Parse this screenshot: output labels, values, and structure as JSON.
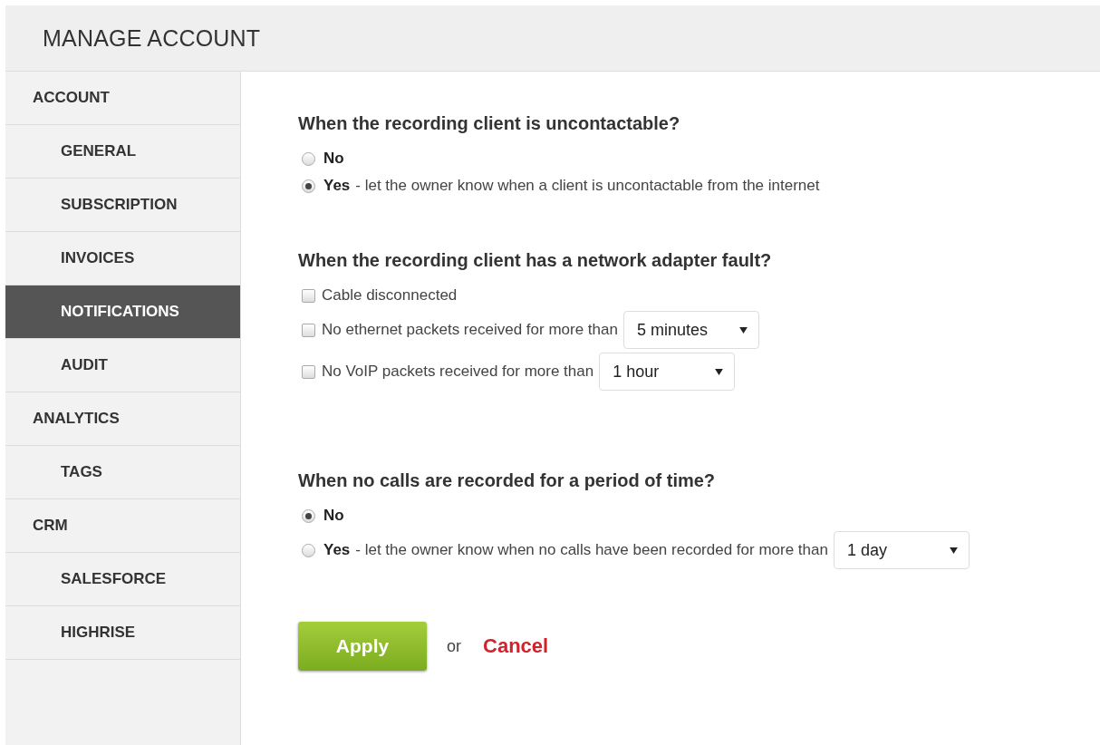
{
  "header": {
    "title": "MANAGE ACCOUNT"
  },
  "sidebar": {
    "items": [
      {
        "label": "ACCOUNT",
        "selected": false,
        "children": [
          {
            "label": "GENERAL",
            "selected": false
          },
          {
            "label": "SUBSCRIPTION",
            "selected": false
          },
          {
            "label": "INVOICES",
            "selected": false
          },
          {
            "label": "NOTIFICATIONS",
            "selected": true
          },
          {
            "label": "AUDIT",
            "selected": false
          }
        ]
      },
      {
        "label": "ANALYTICS",
        "selected": false,
        "children": [
          {
            "label": "TAGS",
            "selected": false
          }
        ]
      },
      {
        "label": "CRM",
        "selected": false,
        "children": [
          {
            "label": "SALESFORCE",
            "selected": false
          },
          {
            "label": "HIGHRISE",
            "selected": false
          }
        ]
      }
    ]
  },
  "sections": [
    {
      "title": "When the recording client is uncontactable?",
      "options": [
        {
          "kind": "radio",
          "selected": false,
          "label": "No"
        },
        {
          "kind": "radio",
          "selected": true,
          "label": "Yes",
          "description": "- let the owner know when a client is uncontactable from the internet"
        }
      ]
    },
    {
      "title": "When the recording client has a network adapter fault?",
      "options": [
        {
          "kind": "checkbox",
          "checked": false,
          "text": "Cable disconnected"
        },
        {
          "kind": "checkbox",
          "checked": false,
          "text": "No ethernet packets received for more than",
          "select": "5 minutes"
        },
        {
          "kind": "checkbox",
          "checked": false,
          "text": "No VoIP packets received for more than",
          "select": "1 hour"
        }
      ]
    },
    {
      "title": "When no calls are recorded for a period of time?",
      "options": [
        {
          "kind": "radio",
          "selected": true,
          "label": "No"
        },
        {
          "kind": "radio",
          "selected": false,
          "label": "Yes",
          "description": "- let the owner know when no calls have been recorded for more than",
          "select": "1 day"
        }
      ]
    }
  ],
  "actions": {
    "apply": "Apply",
    "separator": "or",
    "cancel": "Cancel"
  }
}
